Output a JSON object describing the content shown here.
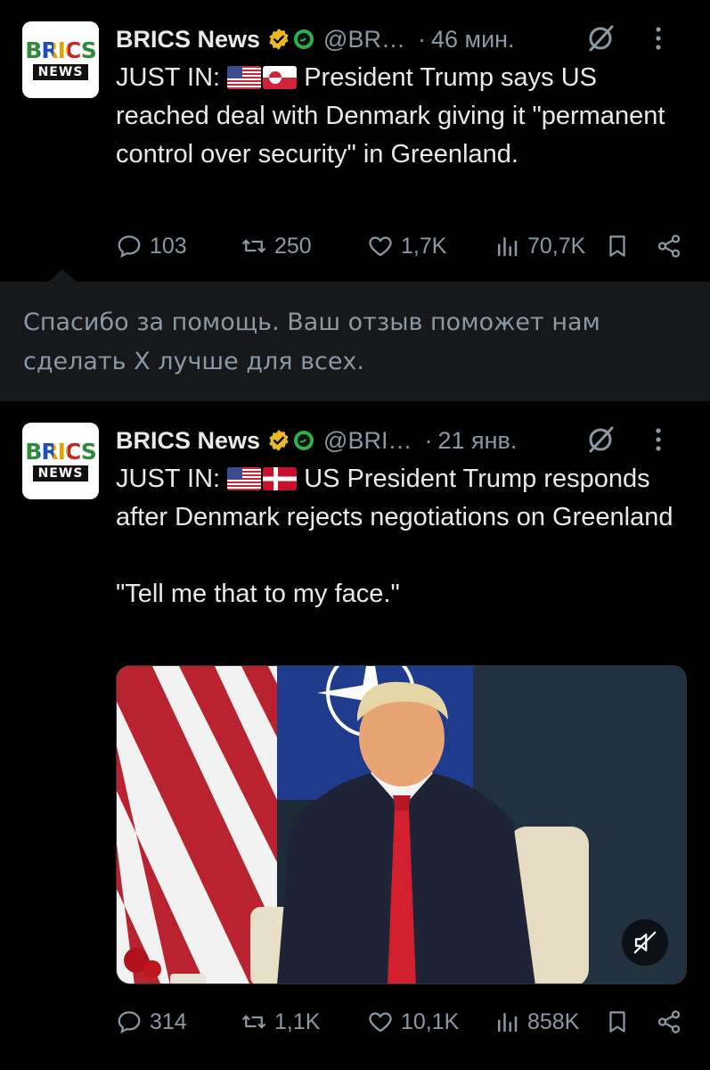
{
  "tweets": [
    {
      "author_name": "BRICS News",
      "handle": "@BR…",
      "separator": "·",
      "time": "46 мин.",
      "avatar_top": "BRICS",
      "avatar_bottom": "NEWS",
      "text_prefix": "JUST IN: ",
      "flags": [
        "us-flag",
        "greenland-flag"
      ],
      "text_rest": " President Trump says US reached deal with Denmark giving it \"permanent control over security\" in Greenland.",
      "stats": {
        "replies": "103",
        "reposts": "250",
        "likes": "1,7K",
        "views": "70,7K"
      }
    },
    {
      "author_name": "BRICS News",
      "handle": "@BRI…",
      "separator": "·",
      "time": "21 янв.",
      "avatar_top": "BRICS",
      "avatar_bottom": "NEWS",
      "text_prefix": "JUST IN: ",
      "flags": [
        "us-flag",
        "denmark-flag"
      ],
      "text_rest": " US President Trump responds after Denmark rejects negotiations on Greenland",
      "quote": "\"Tell me that to my face.\"",
      "media": {
        "type": "video",
        "description_icon": "muted-speaker-icon"
      },
      "stats": {
        "replies": "314",
        "reposts": "1,1K",
        "likes": "10,1K",
        "views": "858K"
      }
    }
  ],
  "feedback": {
    "message": "Спасибо за помощь. Ваш отзыв поможет нам сделать X лучше для всех."
  },
  "colors": {
    "background": "#000000",
    "text": "#e7e9ea",
    "muted": "#8b98a5",
    "verified_gold": "#e8b923",
    "feedback_bg": "#16181c"
  }
}
